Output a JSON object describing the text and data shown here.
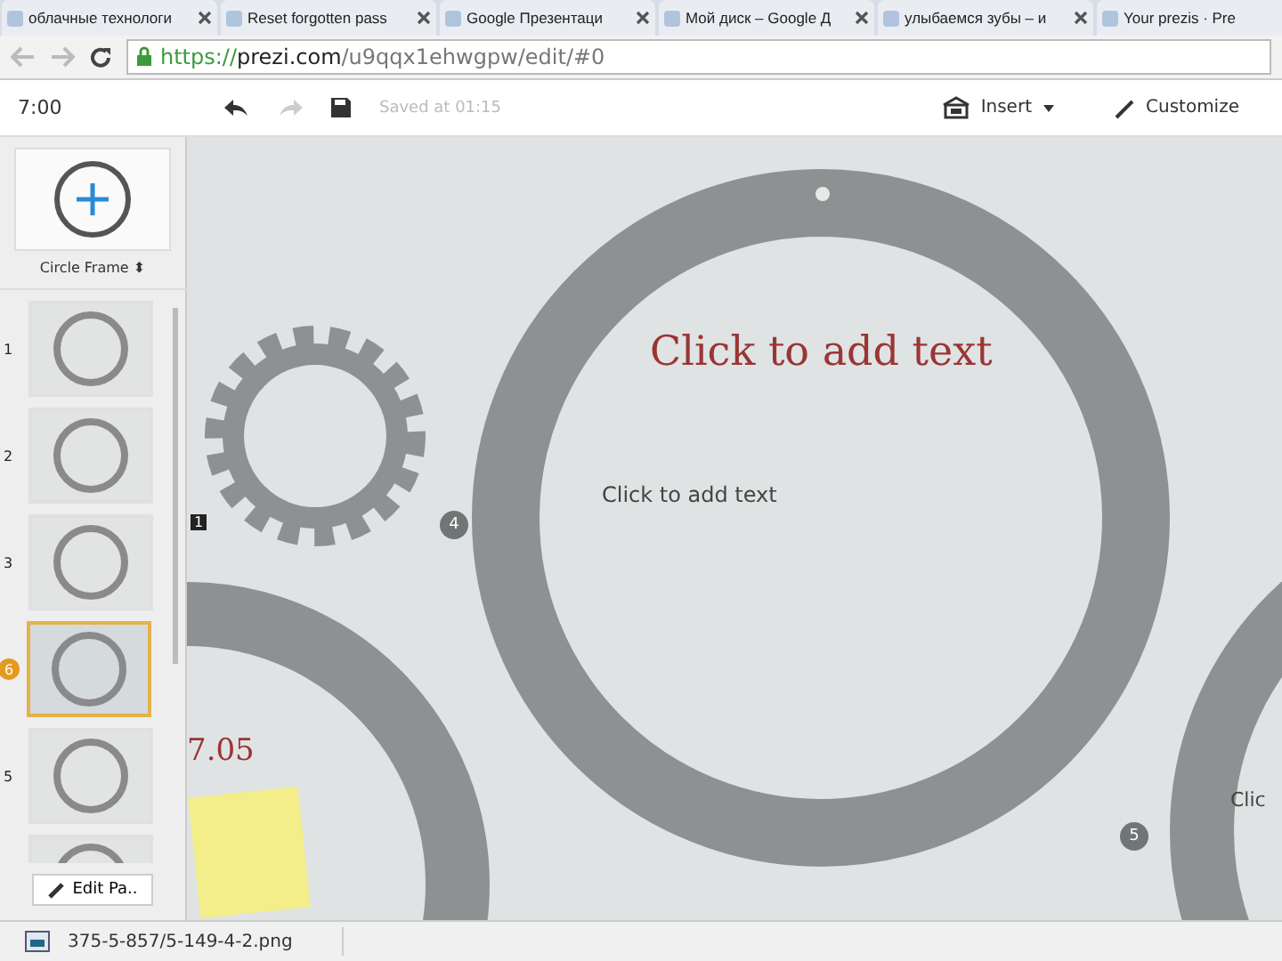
{
  "browser": {
    "tabs": [
      {
        "title": "облачные технологи"
      },
      {
        "title": "Reset forgotten pass"
      },
      {
        "title": "Google Презентаци"
      },
      {
        "title": "Мой диск – Google Д"
      },
      {
        "title": "улыбаемся зубы – и"
      },
      {
        "title": "Your prezis · Pre"
      }
    ],
    "address": {
      "secure": "https://",
      "host": "prezi.com",
      "path": "/u9qqx1ehwgpw/edit/#0"
    }
  },
  "toolbar": {
    "time": "7:00",
    "saved": "Saved at 01:15",
    "insert": "Insert",
    "customize": "Customize"
  },
  "sidebar": {
    "frame_type": "Circle Frame",
    "frame_type_caret": "⬍",
    "slides": [
      {
        "number": "1",
        "selected": false
      },
      {
        "number": "2",
        "selected": false
      },
      {
        "number": "3",
        "selected": false
      },
      {
        "badge": "6",
        "selected": true
      },
      {
        "number": "5",
        "selected": false
      },
      {
        "selected": false
      }
    ],
    "edit_path": "Edit Pa.."
  },
  "canvas": {
    "title": "Click to add text",
    "body": "Click to add text",
    "frame_tag": "1",
    "markers": [
      "4",
      "5"
    ],
    "side_label": "7.05",
    "edge_text": "Clic"
  },
  "download_bar": {
    "file": "375-5-857/5-149-4-2.png"
  }
}
